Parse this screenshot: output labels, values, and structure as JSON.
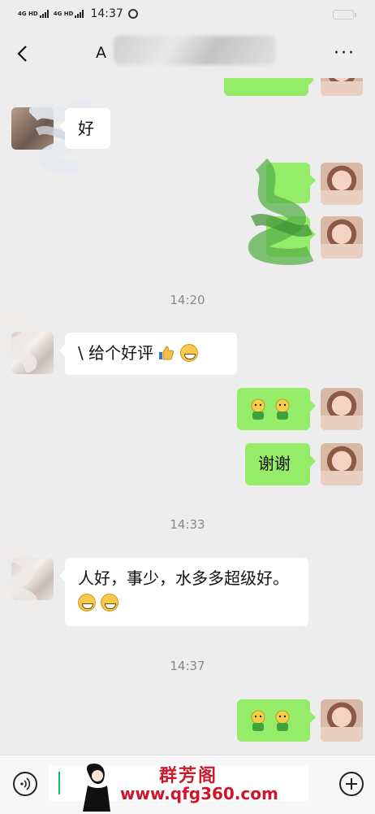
{
  "status_bar": {
    "network_1": "4G HD",
    "network_2": "4G HD",
    "time": "14:37"
  },
  "header": {
    "title_visible": "A"
  },
  "messages": [
    {
      "side": "right",
      "text": ""
    },
    {
      "side": "left",
      "text": "好"
    },
    {
      "side": "right",
      "text": ""
    },
    {
      "side": "right",
      "text": ""
    },
    {
      "type": "time",
      "text": "14:20"
    },
    {
      "side": "left",
      "text": "\\ 给个好评",
      "emoji": [
        "thumbs-up-icon",
        "grinning-face-icon"
      ]
    },
    {
      "side": "right",
      "text": "",
      "emoji": [
        "frog-icon",
        "frog-icon"
      ]
    },
    {
      "side": "right",
      "text": "谢谢"
    },
    {
      "type": "time",
      "text": "14:33"
    },
    {
      "side": "left",
      "text": "人好，事少，水多多超级好。",
      "emoji": [
        "grinning-face-icon",
        "grinning-face-icon"
      ]
    },
    {
      "type": "time",
      "text": "14:37"
    },
    {
      "side": "right",
      "text": "",
      "emoji": [
        "frog-icon",
        "frog-icon"
      ]
    }
  ],
  "watermark": {
    "title": "群芳阁",
    "url": "www.qfg360.com"
  },
  "colors": {
    "background": "#ededed",
    "bubble_sent": "#95ec69",
    "bubble_received": "#ffffff",
    "accent": "#07c160",
    "watermark_red": "#d0152a"
  }
}
